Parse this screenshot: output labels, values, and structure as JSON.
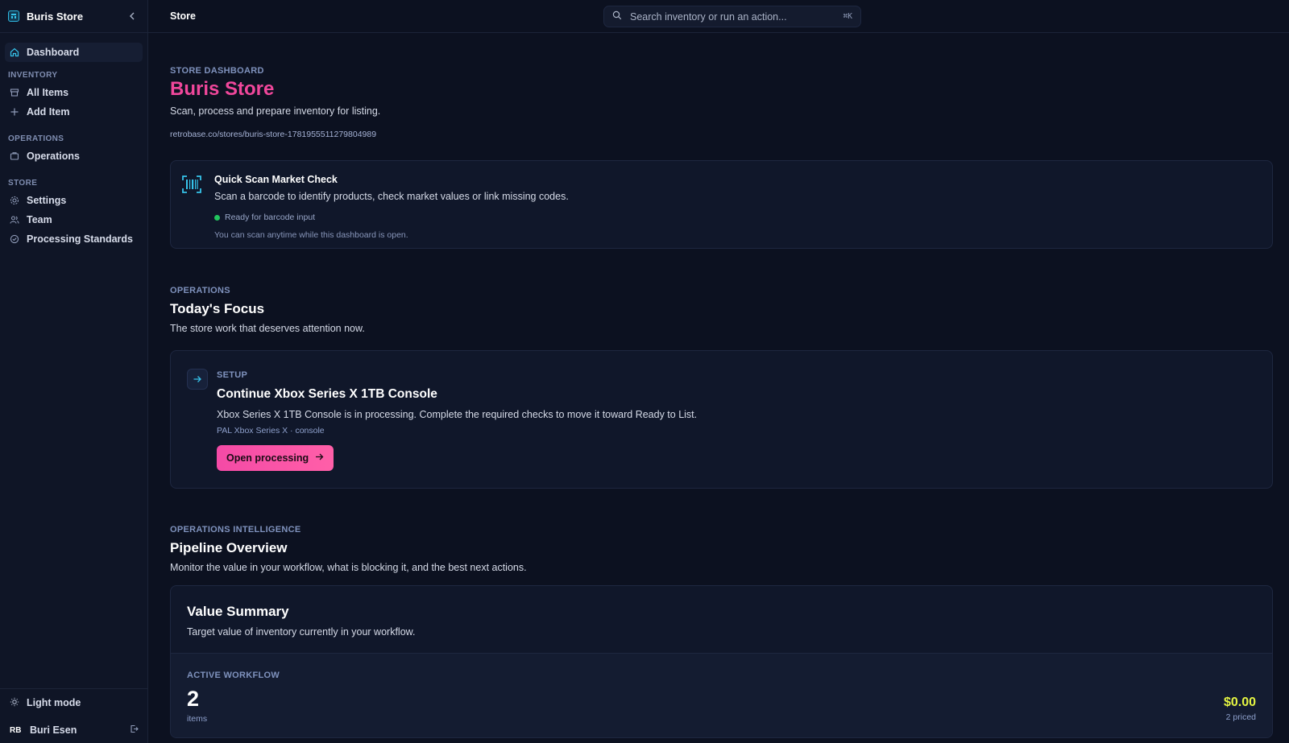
{
  "sidebar": {
    "brand": "Buris Store",
    "items": {
      "dashboard": "Dashboard",
      "all_items": "All Items",
      "add_item": "Add Item",
      "operations": "Operations",
      "settings": "Settings",
      "team": "Team",
      "processing_standards": "Processing Standards"
    },
    "sections": {
      "inventory": "INVENTORY",
      "operations": "OPERATIONS",
      "store": "STORE"
    },
    "footer": {
      "theme_toggle": "Light mode",
      "user_initials": "RB",
      "user_name": "Buri Esen"
    }
  },
  "topbar": {
    "title": "Store",
    "search_placeholder": "Search inventory or run an action...",
    "shortcut": "⌘K"
  },
  "header": {
    "eyebrow": "STORE DASHBOARD",
    "title": "Buris Store",
    "subtitle": "Scan, process and prepare inventory for listing.",
    "url": "retrobase.co/stores/buris-store-1781955511279804989"
  },
  "scan_card": {
    "title": "Quick Scan Market Check",
    "text": "Scan a barcode to identify products, check market values or link missing codes.",
    "status": "Ready for barcode input",
    "hint": "You can scan anytime while this dashboard is open."
  },
  "focus": {
    "eyebrow": "OPERATIONS",
    "title": "Today's Focus",
    "subtitle": "The store work that deserves attention now.",
    "card": {
      "tag": "SETUP",
      "title": "Continue Xbox Series X 1TB Console",
      "text": "Xbox Series X 1TB Console is in processing. Complete the required checks to move it toward Ready to List.",
      "meta": "PAL Xbox Series X · console",
      "button": "Open processing"
    }
  },
  "pipeline": {
    "eyebrow": "OPERATIONS INTELLIGENCE",
    "title": "Pipeline Overview",
    "subtitle": "Monitor the value in your workflow, what is blocking it, and the best next actions.",
    "value_summary": {
      "title": "Value Summary",
      "subtitle": "Target value of inventory currently in your workflow.",
      "label": "ACTIVE WORKFLOW",
      "count": "2",
      "count_label": "items",
      "amount": "$0.00",
      "amount_label": "2 priced"
    }
  },
  "colors": {
    "accent_pink": "#f0479b",
    "accent_cyan": "#36c3ea",
    "status_green": "#22c55e",
    "money_yellow": "#e5f542"
  }
}
